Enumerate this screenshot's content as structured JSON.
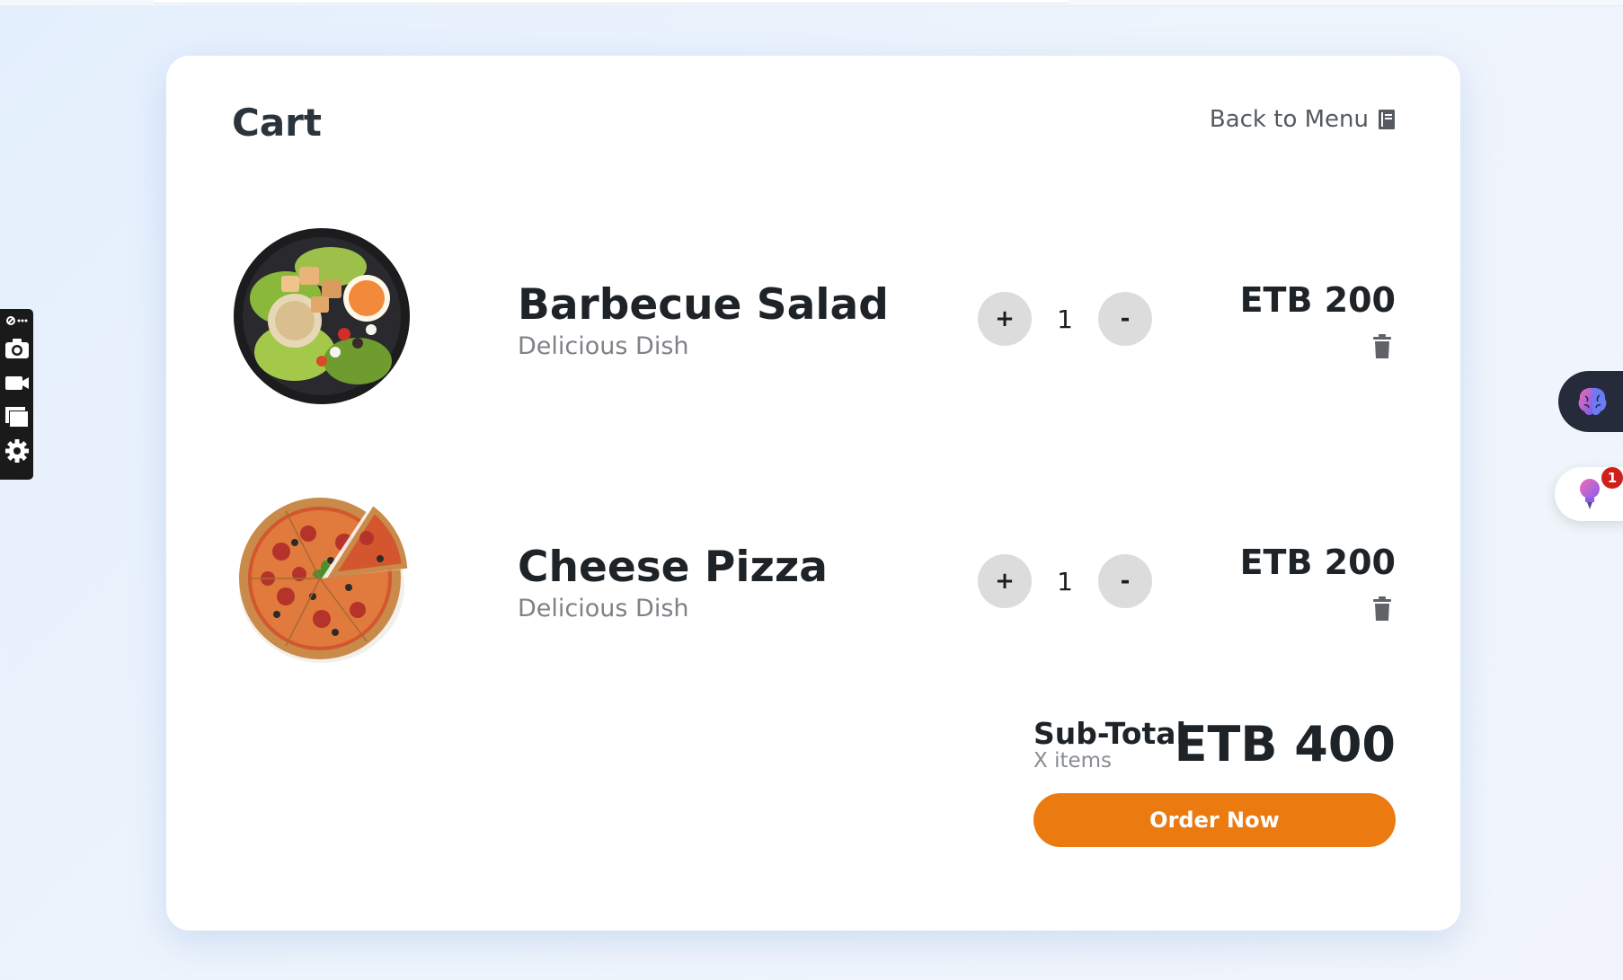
{
  "cart": {
    "title": "Cart",
    "back_label": "Back to Menu"
  },
  "items": [
    {
      "name": "Barbecue Salad",
      "description": "Delicious Dish",
      "quantity": "1",
      "price": "ETB 200",
      "plus_label": "+",
      "minus_label": "-"
    },
    {
      "name": "Cheese Pizza",
      "description": "Delicious Dish",
      "quantity": "1",
      "price": "ETB 200",
      "plus_label": "+",
      "minus_label": "-"
    }
  ],
  "summary": {
    "subtotal_label": "Sub-Total",
    "items_label": "X items",
    "total": "ETB 400",
    "order_button": "Order Now"
  },
  "widgets": {
    "notification_count": "1"
  },
  "colors": {
    "accent": "#eb7b10",
    "title_text": "#2b333d",
    "muted_text": "#7e8287",
    "qty_button_bg": "#dcdcdc",
    "badge": "#d0201c"
  },
  "icons": [
    "book-icon",
    "trash-icon",
    "camera-icon",
    "video-camera-icon",
    "window-stack-icon",
    "gear-icon",
    "brain-icon",
    "lightbulb-icon",
    "salad-bowl-image",
    "pizza-image"
  ]
}
